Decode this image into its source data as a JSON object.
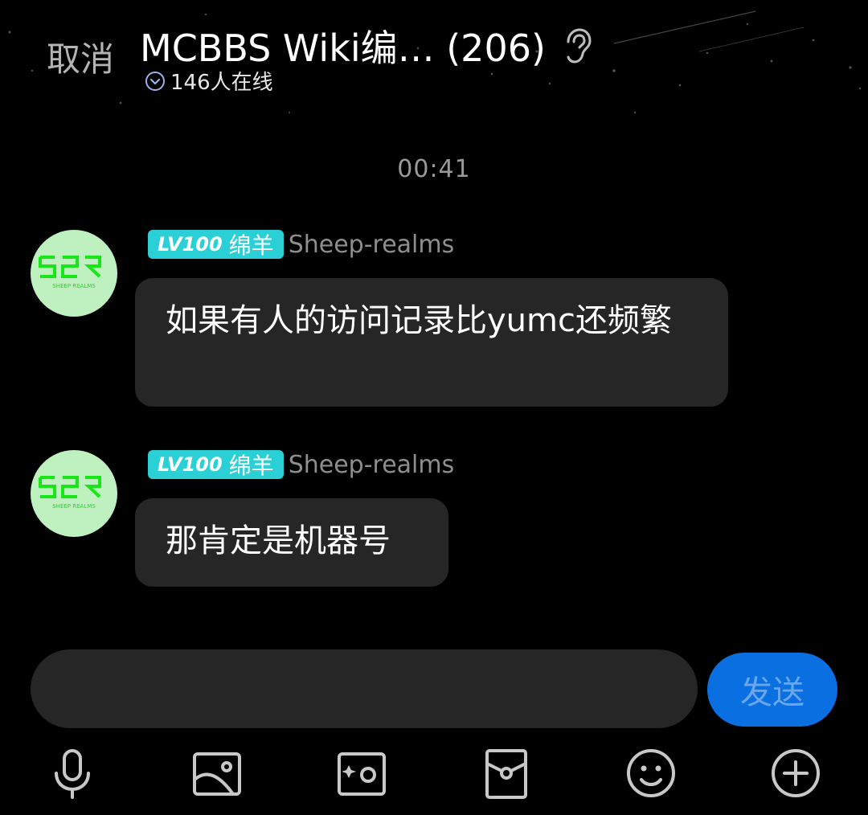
{
  "header": {
    "cancel_label": "取消",
    "title": "MCBBS Wiki编… (206)",
    "online_text": "146人在线"
  },
  "timestamp": "00:41",
  "messages": [
    {
      "level": "LV100",
      "member_title": "绵羊",
      "sender": "Sheep-realms",
      "text": "如果有人的访问记录比yumc还频繁"
    },
    {
      "level": "LV100",
      "member_title": "绵羊",
      "sender": "Sheep-realms",
      "text": "那肯定是机器号"
    }
  ],
  "composer": {
    "input_value": "",
    "send_label": "发送"
  },
  "toolbar": [
    "microphone-icon",
    "image-icon",
    "camera-icon",
    "red-packet-icon",
    "emoji-icon",
    "plus-icon"
  ],
  "colors": {
    "background": "#000000",
    "badge": "#2ad0d6",
    "bubble": "#262626",
    "send": "#0a6fe0",
    "avatar_bg": "#bff0bf",
    "avatar_logo": "#19e619"
  }
}
